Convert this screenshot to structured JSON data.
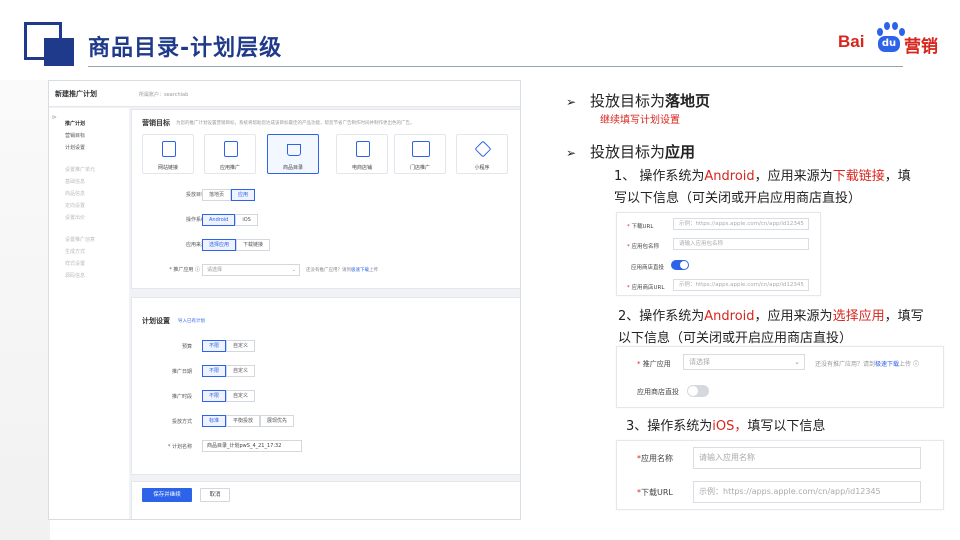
{
  "slide": {
    "title": "商品目录-计划层级",
    "logo": {
      "bai": "Bai",
      "du": "du",
      "yingxiao": "营销"
    }
  },
  "shot": {
    "window_title": "新建推广计划",
    "breadcrumb": "所属账户：searchlab",
    "sidebar": {
      "items": [
        {
          "label": "推广计划",
          "dim": false
        },
        {
          "label": "营销目标",
          "dim": false
        },
        {
          "label": "计划设置",
          "dim": false
        },
        {
          "label": "设置推广单元",
          "dim": true
        },
        {
          "label": "基础信息",
          "dim": true
        },
        {
          "label": "商品信息",
          "dim": true
        },
        {
          "label": "定向设置",
          "dim": true
        },
        {
          "label": "设置出价",
          "dim": true
        },
        {
          "label": "设置推广创意",
          "dim": true
        },
        {
          "label": "生成方式",
          "dim": true
        },
        {
          "label": "样式设置",
          "dim": true
        },
        {
          "label": "源码信息",
          "dim": true
        }
      ]
    },
    "marketing": {
      "title": "营销目标",
      "desc": "为您的推广计划设置营销目标，系统将帮助您达成该目标最佳的产品功能，帮您节省广告制作时间并制作更出色的广告。",
      "cards": [
        {
          "label": "网站链接",
          "selected": false
        },
        {
          "label": "应用推广",
          "selected": false
        },
        {
          "label": "商品目录",
          "selected": true
        },
        {
          "label": "电商店铺",
          "selected": false
        },
        {
          "label": "门店推广",
          "selected": false
        },
        {
          "label": "小程序",
          "selected": false
        }
      ],
      "delivery_target_label": "投放目标",
      "delivery_target_options": [
        "落地页",
        "应用"
      ],
      "os_label": "操作系统",
      "os_options": [
        "Android",
        "iOS"
      ],
      "app_source_label": "应用来源",
      "app_source_options": [
        "选择应用",
        "下载链接"
      ],
      "app_label": "* 推广应用 ⓘ",
      "app_placeholder": "请选择",
      "app_hint_prefix": "还没有推广应用？请到",
      "app_hint_link": "极速下载",
      "app_hint_suffix": "上传"
    },
    "plan": {
      "title": "计划设置",
      "import_link": "导入已有计划",
      "budget_label": "预算",
      "budget_options": [
        "不限",
        "自定义"
      ],
      "date_label": "推广日期",
      "date_options": [
        "不限",
        "自定义"
      ],
      "time_label": "推广时段",
      "time_options": [
        "不限",
        "自定义"
      ],
      "method_label": "投放方式",
      "method_options": [
        "标准",
        "平衡投放",
        "展现优先"
      ],
      "name_label": "* 计划名称",
      "name_value": "商品目录_计划pwS_4_21_17:32"
    },
    "footer": {
      "save": "保存并继续",
      "cancel": "取消"
    }
  },
  "right": {
    "bullet1_prefix": "投放目标为",
    "bullet1_bold": "落地页",
    "bullet1_note": "继续填写计划设置",
    "bullet2_prefix": "投放目标为",
    "bullet2_bold": "应用",
    "item1_line1_a": "1、 操作系统为",
    "item1_line1_red1": "Android",
    "item1_line1_b": "，应用来源为",
    "item1_line1_red2": "下载链接",
    "item1_line1_c": "，填",
    "item1_line2": "写以下信息（可关闭或开启应用商店直投）",
    "item2_line1_a": "2、操作系统为",
    "item2_line1_red1": "Android",
    "item2_line1_b": "，应用来源为",
    "item2_line1_red2": "选择应用",
    "item2_line1_c": "，填写",
    "item2_line2": "以下信息（可关闭或开启应用商店直投）",
    "item3_a": "3、操作系统为",
    "item3_red": "iOS，",
    "item3_b": "填写以下信息"
  },
  "mini1": {
    "rows": [
      {
        "label": "下载URL",
        "placeholder": "示例：https://apps.apple.com/cn/app/id12345"
      },
      {
        "label": "应用包名称",
        "placeholder": "请输入应用包名称"
      },
      {
        "label": "应用商店直投",
        "toggle": true
      },
      {
        "label": "应用商店URL",
        "placeholder": "示例：https://apps.apple.com/cn/app/id12345"
      }
    ]
  },
  "mini2": {
    "app_label": "推广应用",
    "app_placeholder": "请选择",
    "hint_prefix": "还没有推广应用？请到",
    "hint_link": "极速下载",
    "hint_suffix": "上传",
    "store_label": "应用商店直投",
    "toggle_on": false
  },
  "mini3": {
    "name_label": "应用名称",
    "name_placeholder": "请输入应用名称",
    "url_label": "下载URL",
    "url_placeholder": "示例：https://apps.apple.com/cn/app/id12345"
  },
  "colors": {
    "brand_blue": "#2d63e8",
    "title_navy": "#1f3a8a",
    "accent_red": "#d7261e"
  }
}
